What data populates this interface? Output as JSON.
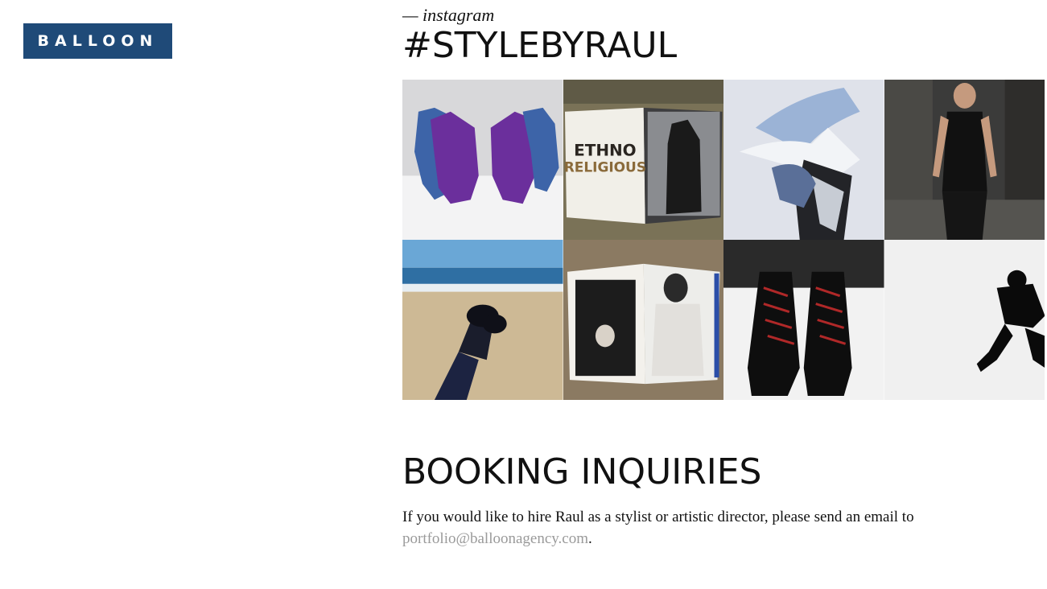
{
  "header": {
    "logo_text": "BALLOON"
  },
  "instagram": {
    "kicker": "— instagram",
    "title": "#STYLEBYRAUL",
    "tiles": [
      {
        "icon": "purple-gloves-photo"
      },
      {
        "icon": "ethno-religious-magazine-photo"
      },
      {
        "icon": "abstract-fashion-sculpture-photo"
      },
      {
        "icon": "runway-model-photo"
      },
      {
        "icon": "beach-boots-photo"
      },
      {
        "icon": "magazine-spread-photo"
      },
      {
        "icon": "black-boots-red-laces-photo"
      },
      {
        "icon": "running-silhouette-photo"
      }
    ],
    "magazine_text_line1": "ETHNO",
    "magazine_text_line2": "RELIGIOUS"
  },
  "booking": {
    "title": "BOOKING INQUIRIES",
    "text": "If you would like to hire Raul as a stylist or artistic director, please send an email to",
    "email": "portfolio@balloonagency.com",
    "trailing": "."
  },
  "colors": {
    "brand": "#1f4a78",
    "link": "#9a9a9a"
  }
}
